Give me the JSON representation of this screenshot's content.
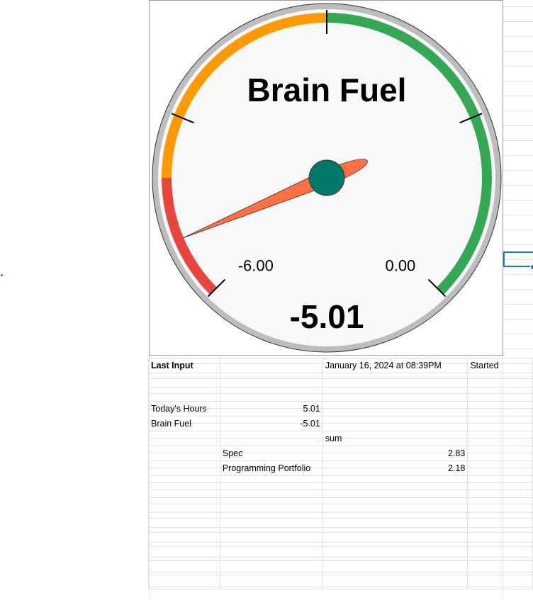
{
  "gauge": {
    "title": "Brain Fuel",
    "value": -5.01,
    "value_label": "-5.01",
    "min": -6,
    "max": 6,
    "min_label": "-6.00",
    "max_label": "0.00",
    "bands": [
      {
        "from": -6,
        "to": -4,
        "color": "#e8453c"
      },
      {
        "from": -4,
        "to": 0,
        "color": "#ff9900"
      },
      {
        "from": 0,
        "to": 6,
        "color": "#34a853"
      }
    ],
    "colors": {
      "needle": "#ff7043",
      "hub": "#00796b",
      "ring": "#bdbdbd",
      "face": "#f8f8f8"
    }
  },
  "sheet": {
    "rows": [
      [
        "Last Input",
        "",
        "January 16, 2024 at 08:39PM",
        "Started"
      ],
      [
        "",
        "",
        "",
        ""
      ],
      [
        "",
        "",
        "",
        ""
      ],
      [
        "Today's Hours",
        "5.01",
        "",
        ""
      ],
      [
        "Brain Fuel",
        "-5.01",
        "",
        ""
      ],
      [
        "",
        "",
        "sum",
        ""
      ],
      [
        "",
        "Spec",
        "2.83",
        ""
      ],
      [
        "",
        "Programming Portfolio",
        "2.18",
        ""
      ],
      [
        "",
        "",
        "",
        ""
      ],
      [
        "",
        "",
        "",
        ""
      ],
      [
        "",
        "",
        "",
        ""
      ],
      [
        "",
        "",
        "",
        ""
      ],
      [
        "",
        "",
        "",
        ""
      ],
      [
        "",
        "",
        "",
        ""
      ],
      [
        "",
        "",
        "",
        ""
      ],
      [
        "",
        "",
        "",
        ""
      ]
    ]
  }
}
